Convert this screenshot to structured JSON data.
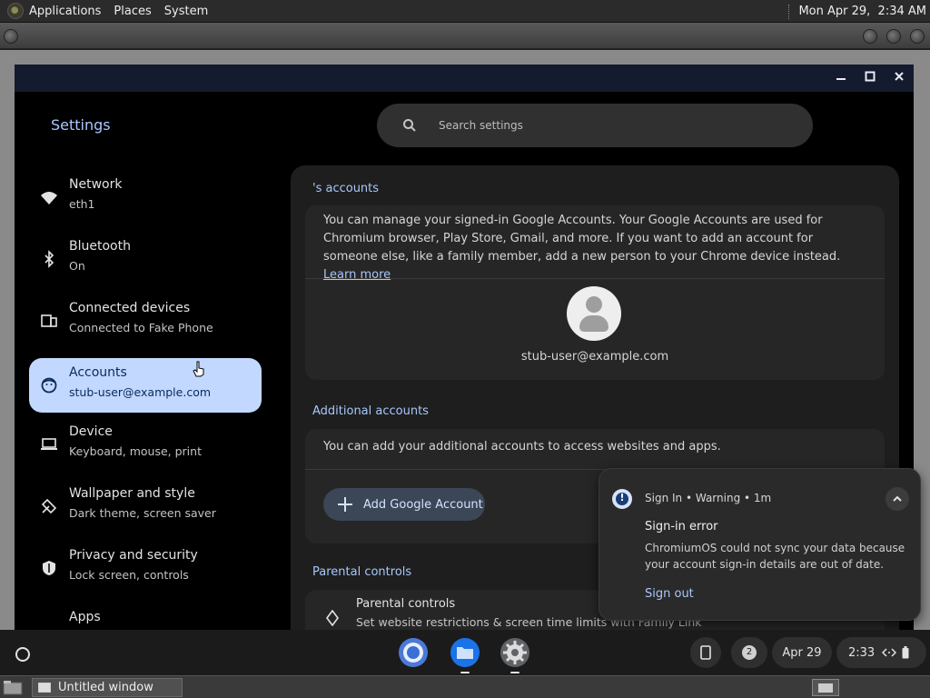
{
  "top_panel": {
    "menus": [
      "Applications",
      "Places",
      "System"
    ],
    "clock": "Mon Apr 29,  2:34 AM"
  },
  "window": {
    "app_title": "Settings",
    "controls": {
      "minimize": "minimize-icon",
      "maximize": "maximize-icon",
      "close": "close-icon"
    }
  },
  "search": {
    "placeholder": "Search settings",
    "icon": "search-icon"
  },
  "sidebar": {
    "items": [
      {
        "label": "Network",
        "sublabel": "eth1",
        "icon": "wifi-icon"
      },
      {
        "label": "Bluetooth",
        "sublabel": "On",
        "icon": "bluetooth-icon"
      },
      {
        "label": "Connected devices",
        "sublabel": "Connected to Fake Phone",
        "icon": "connected-devices-icon"
      },
      {
        "label": "Accounts",
        "sublabel": "stub-user@example.com",
        "icon": "accounts-icon",
        "active": true
      },
      {
        "label": "Device",
        "sublabel": "Keyboard, mouse, print",
        "icon": "laptop-icon"
      },
      {
        "label": "Wallpaper and style",
        "sublabel": "Dark theme, screen saver",
        "icon": "palette-icon"
      },
      {
        "label": "Privacy and security",
        "sublabel": "Lock screen, controls",
        "icon": "shield-icon"
      },
      {
        "label": "Apps",
        "sublabel": "",
        "icon": "apps-icon"
      }
    ]
  },
  "main": {
    "accounts_title": "'s accounts",
    "accounts_desc": "You can manage your signed-in Google Accounts. Your Google Accounts are used for Chromium browser, Play Store, Gmail, and more. If you want to add an account for someone else, like a family member, add a new person to your Chrome device instead.",
    "learn_more": "Learn more",
    "user_email": "stub-user@example.com",
    "additional_title": "Additional accounts",
    "additional_desc": "You can add your additional accounts to access websites and apps.",
    "add_button": "Add Google Account",
    "parental_title": "Parental controls",
    "parental_item_label": "Parental controls",
    "parental_item_sub": "Set website restrictions & screen time limits with Family Link"
  },
  "notification": {
    "source": "Sign In",
    "severity": "Warning",
    "time": "1m",
    "title": "Sign-in error",
    "body": "ChromiumOS could not sync your data because your account sign-in details are out of date.",
    "action": "Sign out"
  },
  "shelf": {
    "apps": [
      "chrome-icon",
      "files-icon",
      "settings-gear-icon"
    ],
    "notification_count": "2",
    "date": "Apr 29",
    "time": "2:33"
  },
  "taskbar": {
    "window_title": "Untitled window"
  },
  "colors": {
    "accent": "#a8c7fa",
    "active_bg": "#c2d8ff",
    "warning_icon": "#1b3d75"
  }
}
